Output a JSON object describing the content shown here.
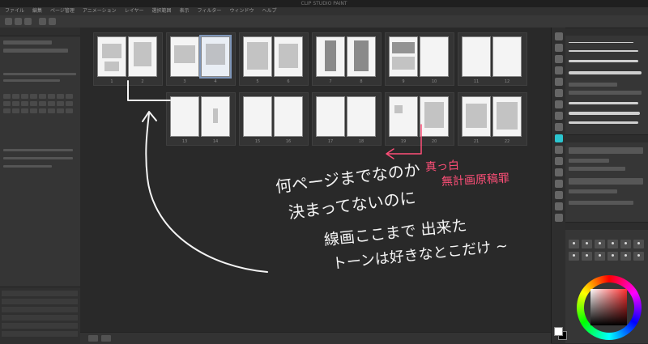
{
  "window": {
    "title": "CLIP STUDIO PAINT"
  },
  "menu": [
    "ファイル",
    "編集",
    "ページ管理",
    "アニメーション",
    "レイヤー",
    "選択範囲",
    "表示",
    "フィルター",
    "ウィンドウ",
    "ヘルプ"
  ],
  "pages": {
    "top": [
      {
        "left": "1",
        "right": "2"
      },
      {
        "left": "3",
        "right": "4",
        "selected": "right"
      },
      {
        "left": "5",
        "right": "6"
      },
      {
        "left": "7",
        "right": "8"
      },
      {
        "left": "9",
        "right": "10"
      },
      {
        "left": "11",
        "right": "12"
      }
    ],
    "bottom": [
      {
        "left": "13",
        "right": "14"
      },
      {
        "left": "15",
        "right": "16"
      },
      {
        "left": "17",
        "right": "18"
      },
      {
        "left": "19",
        "right": "20"
      },
      {
        "left": "21",
        "right": "22"
      }
    ]
  },
  "annotations": {
    "pink_line1": "真っ白",
    "pink_line2": "無計画原稿罪",
    "white_line1": "何ページまでなのか",
    "white_line2": "決まってないのに",
    "white_line3": "線画ここまで 出来た",
    "white_line4": "トーンは好きなとこだけ ~"
  },
  "colors": {
    "annotation_white": "#f4f4f4",
    "annotation_pink": "#ff4f78",
    "tool_active": "#2bc5cf"
  }
}
